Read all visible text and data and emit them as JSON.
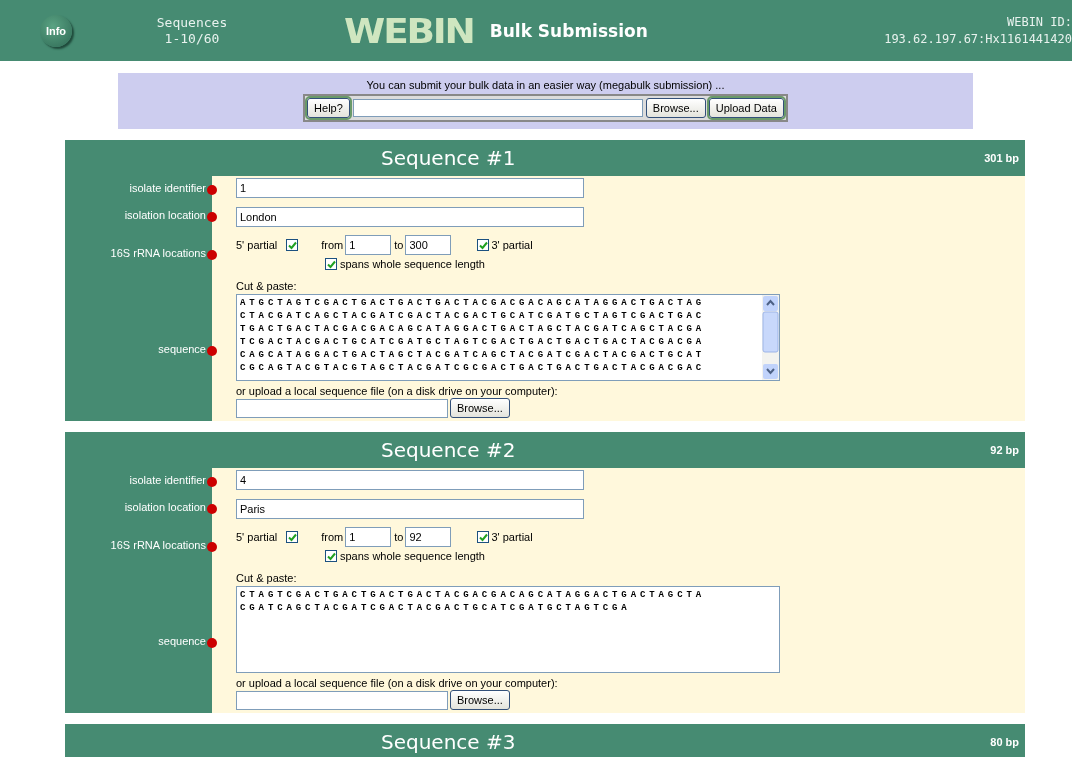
{
  "header": {
    "info_button": "Info",
    "sequences_label": "Sequences",
    "sequences_range": "1-10/60",
    "logo": "WEBIN",
    "title": "Bulk Submission",
    "webin_id_label": "WEBIN ID:",
    "webin_id": "193.62.197.67:Hx1161441420"
  },
  "megabulk": {
    "message": "You can submit your bulk data in an easier way (megabulk submission) ...",
    "help_button": "Help?",
    "browse_button": "Browse...",
    "upload_button": "Upload Data"
  },
  "sequences": [
    {
      "title": "Sequence #1",
      "length": "301 bp",
      "identifier": {
        "label": "isolate identifier",
        "value": "1"
      },
      "location": {
        "label": "isolation location",
        "value": "London"
      },
      "rrna": {
        "label": "16S rRNA locations",
        "five_prime_label": "5' partial",
        "five_prime_checked": true,
        "from_label": "from",
        "from": "1",
        "to_label": "to",
        "to": "300",
        "three_prime_label": "3' partial",
        "three_prime_checked": true,
        "spans_label": "spans whole sequence length",
        "spans_checked": true
      },
      "sequence": {
        "label": "sequence",
        "cut_paste_label": "Cut & paste:",
        "lines": [
          "ATGCTAGTCGACTGACTGACTGACTACGACGACAGCATAGGACTGACTAG",
          "CTACGATCAGCTACGATCGACTACGACTGCATCGATGCTAGTCGACTGAC",
          "TGACTGACTACGACGACAGCATAGGACTGACTAGCTACGATCAGCTACGA",
          "TCGACTACGACTGCATCGATGCTAGTCGACTGACTGACTGACTACGACGA",
          "CAGCATAGGACTGACTAGCTACGATCAGCTACGATCGACTACGACTGCAT",
          "CGCAGTACGTACGTAGCTACGATCGCGACTGACTGACTGACTACGACGAC"
        ],
        "scrollable": true,
        "upload_label": "or upload a local sequence file (on a disk drive on your computer):",
        "browse_button": "Browse..."
      }
    },
    {
      "title": "Sequence #2",
      "length": "92 bp",
      "identifier": {
        "label": "isolate identifier",
        "value": "4"
      },
      "location": {
        "label": "isolation location",
        "value": "Paris"
      },
      "rrna": {
        "label": "16S rRNA locations",
        "five_prime_label": "5' partial",
        "five_prime_checked": true,
        "from_label": "from",
        "from": "1",
        "to_label": "to",
        "to": "92",
        "three_prime_label": "3' partial",
        "three_prime_checked": true,
        "spans_label": "spans whole sequence length",
        "spans_checked": true
      },
      "sequence": {
        "label": "sequence",
        "cut_paste_label": "Cut & paste:",
        "lines": [
          "CTAGTCGACTGACTGACTGACTACGACGACAGCATAGGACTGACTAGCTA",
          "CGATCAGCTACGATCGACTACGACTGCATCGATGCTAGTCGA"
        ],
        "scrollable": false,
        "upload_label": "or upload a local sequence file (on a disk drive on your computer):",
        "browse_button": "Browse..."
      }
    },
    {
      "title": "Sequence #3",
      "length": "80 bp"
    }
  ]
}
